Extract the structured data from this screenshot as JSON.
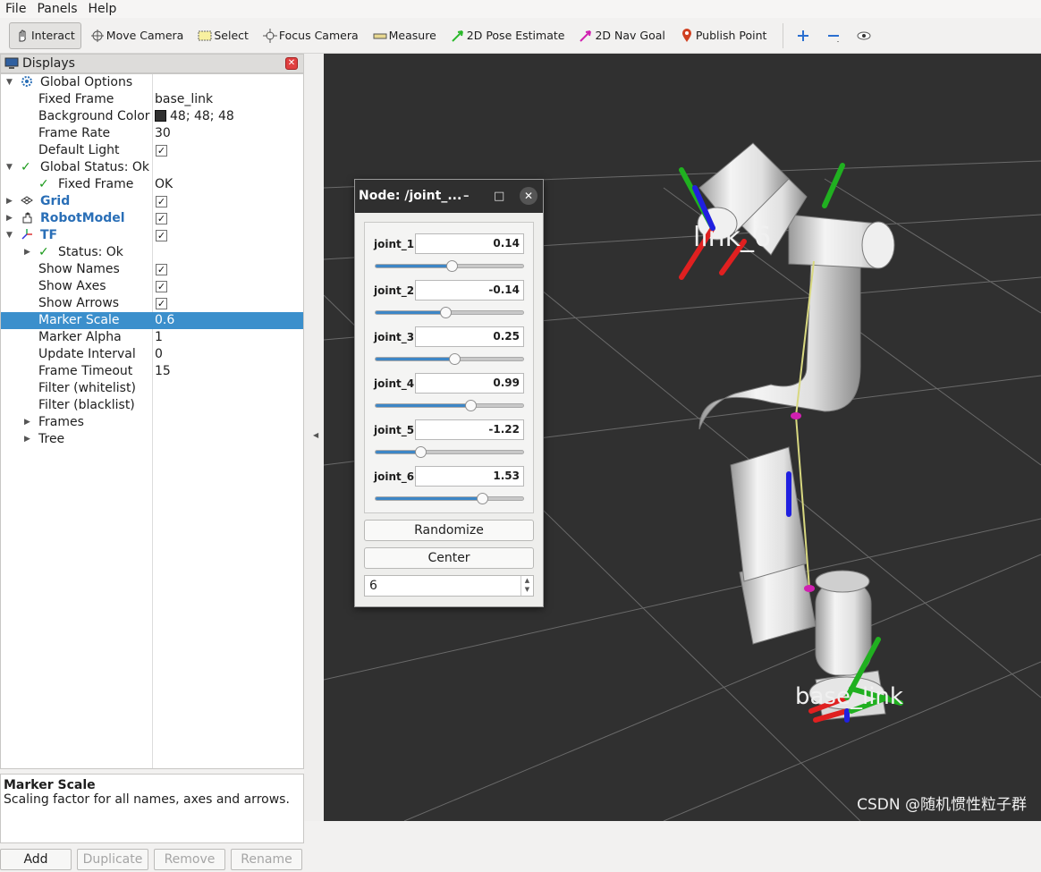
{
  "menubar": {
    "file": "File",
    "panels": "Panels",
    "help": "Help"
  },
  "toolbar": {
    "interact": "Interact",
    "move_camera": "Move Camera",
    "select": "Select",
    "focus_camera": "Focus Camera",
    "measure": "Measure",
    "pose_estimate": "2D Pose Estimate",
    "nav_goal": "2D Nav Goal",
    "publish_point": "Publish Point"
  },
  "displays": {
    "title": "Displays",
    "rows": {
      "global_options": "Global Options",
      "fixed_frame": "Fixed Frame",
      "fixed_frame_val": "base_link",
      "bg_color": "Background Color",
      "bg_color_val": "48; 48; 48",
      "frame_rate": "Frame Rate",
      "frame_rate_val": "30",
      "default_light": "Default Light",
      "global_status": "Global Status: Ok",
      "gs_fixed_frame": "Fixed Frame",
      "gs_fixed_frame_val": "OK",
      "grid": "Grid",
      "robot_model": "RobotModel",
      "tf": "TF",
      "tf_status": "Status: Ok",
      "show_names": "Show Names",
      "show_axes": "Show Axes",
      "show_arrows": "Show Arrows",
      "marker_scale": "Marker Scale",
      "marker_scale_val": "0.6",
      "marker_alpha": "Marker Alpha",
      "marker_alpha_val": "1",
      "update_interval": "Update Interval",
      "update_interval_val": "0",
      "frame_timeout": "Frame Timeout",
      "frame_timeout_val": "15",
      "filter_white": "Filter (whitelist)",
      "filter_black": "Filter (blacklist)",
      "frames": "Frames",
      "tree": "Tree"
    },
    "description": {
      "title": "Marker Scale",
      "text": "Scaling factor for all names, axes and arrows."
    },
    "buttons": {
      "add": "Add",
      "duplicate": "Duplicate",
      "remove": "Remove",
      "rename": "Rename"
    }
  },
  "dialog": {
    "title": "Node: /joint_...",
    "joints": [
      {
        "label": "joint_1",
        "value": "0.14",
        "slider": 0.52
      },
      {
        "label": "joint_2",
        "value": "-0.14",
        "slider": 0.48
      },
      {
        "label": "joint_3",
        "value": "0.25",
        "slider": 0.54
      },
      {
        "label": "joint_4",
        "value": "0.99",
        "slider": 0.65
      },
      {
        "label": "joint_5",
        "value": "-1.22",
        "slider": 0.31
      },
      {
        "label": "joint_6",
        "value": "1.53",
        "slider": 0.73
      }
    ],
    "randomize": "Randomize",
    "center": "Center",
    "count": "6"
  },
  "viewport": {
    "label_link6": "link_6",
    "label_base": "base_link",
    "watermark": "CSDN @随机惯性粒子群"
  },
  "colors": {
    "selection": "#3b8fcc",
    "background": "#303030",
    "accent_blue": "#2a6fb7"
  }
}
